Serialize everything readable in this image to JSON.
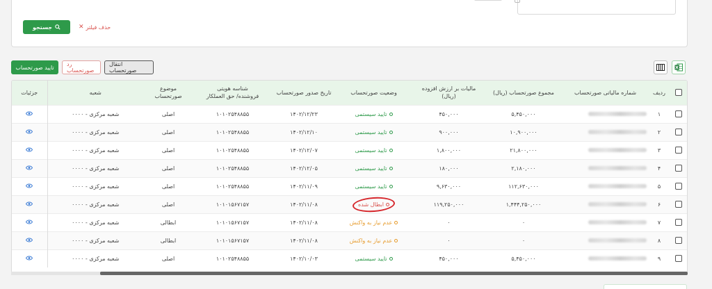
{
  "filters": {
    "search_label": "جستجو",
    "clear_label": "حذف فیلتر"
  },
  "actions": {
    "approve_label": "تایید صورتحساب",
    "reject_label": "رد صورتحساب",
    "transfer_label": "انتقال صورتحساب"
  },
  "table": {
    "headers": {
      "row": "ردیف",
      "tax_number": "شماره مالیاتی صورتحساب",
      "total": "مجموع صورتحساب (ریال)",
      "vat": "مالیات بر ارزش افزوده (ریال)",
      "status": "وضعیت صورتحساب",
      "issue_date": "تاریخ صدور صورتحساب",
      "seller_id_line1": "شناسه هویتی",
      "seller_id_line2": "فروشنده/ حق العملکار",
      "subject": "موضوع صورتحساب",
      "branch": "شعبه",
      "details": "جزئیات"
    },
    "rows": [
      {
        "row": "۱",
        "total": "۵,۴۵۰,۰۰۰",
        "vat": "۴۵۰,۰۰۰",
        "status": "تایید سیستمی",
        "status_type": "green",
        "date": "۱۴۰۲/۱۲/۲۳",
        "seller_id": "۱۰۱۰۲۵۴۸۸۵۵",
        "subject": "اصلی",
        "branch": "شعبه مرکزی - ۰۰۰۰"
      },
      {
        "row": "۲",
        "total": "۱۰,۹۰۰,۰۰۰",
        "vat": "۹۰۰,۰۰۰",
        "status": "تایید سیستمی",
        "status_type": "green",
        "date": "۱۴۰۲/۱۲/۱۰",
        "seller_id": "۱۰۱۰۲۵۴۸۸۵۵",
        "subject": "اصلی",
        "branch": "شعبه مرکزی - ۰۰۰۰"
      },
      {
        "row": "۳",
        "total": "۲۱,۸۰۰,۰۰۰",
        "vat": "۱,۸۰۰,۰۰۰",
        "status": "تایید سیستمی",
        "status_type": "green",
        "date": "۱۴۰۲/۱۲/۰۷",
        "seller_id": "۱۰۱۰۲۵۴۸۸۵۵",
        "subject": "اصلی",
        "branch": "شعبه مرکزی - ۰۰۰۰"
      },
      {
        "row": "۴",
        "total": "۲,۱۸۰,۰۰۰",
        "vat": "۱۸۰,۰۰۰",
        "status": "تایید سیستمی",
        "status_type": "green",
        "date": "۱۴۰۲/۱۲/۰۵",
        "seller_id": "۱۰۱۰۲۵۴۸۸۵۵",
        "subject": "اصلی",
        "branch": "شعبه مرکزی - ۰۰۰۰"
      },
      {
        "row": "۵",
        "total": "۱۱۲,۶۳۰,۰۰۰",
        "vat": "۹,۶۳۰,۰۰۰",
        "status": "تایید سیستمی",
        "status_type": "green",
        "date": "۱۴۰۲/۱۱/۰۹",
        "seller_id": "۱۰۱۰۲۵۴۸۸۵۵",
        "subject": "اصلی",
        "branch": "شعبه مرکزی - ۰۰۰۰"
      },
      {
        "row": "۶",
        "total": "۱,۴۴۴,۲۵۰,۰۰۰",
        "vat": "۱۱۹,۲۵۰,۰۰۰",
        "status": "ابطال شده",
        "status_type": "red",
        "date": "۱۴۰۲/۱۱/۰۸",
        "seller_id": "۱۰۱۰۱۵۶۷۱۵۷",
        "subject": "اصلی",
        "branch": "شعبه مرکزی - ۰۰۰۰"
      },
      {
        "row": "۷",
        "total": "۰",
        "vat": "۰",
        "status": "عدم نیاز به واکنش",
        "status_type": "orange",
        "date": "۱۴۰۲/۱۱/۰۸",
        "seller_id": "۱۰۱۰۱۵۶۷۱۵۷",
        "subject": "ابطالی",
        "branch": "شعبه مرکزی - ۰۰۰۰"
      },
      {
        "row": "۸",
        "total": "۰",
        "vat": "۰",
        "status": "عدم نیاز به واکنش",
        "status_type": "orange",
        "date": "۱۴۰۲/۱۱/۰۸",
        "seller_id": "۱۰۱۰۱۵۶۷۱۵۷",
        "subject": "ابطالی",
        "branch": "شعبه مرکزی - ۰۰۰۰"
      },
      {
        "row": "۹",
        "total": "۵,۴۵۰,۰۰۰",
        "vat": "۴۵۰,۰۰۰",
        "status": "تایید سیستمی",
        "status_type": "green",
        "date": "۱۴۰۲/۱۰/۰۳",
        "seller_id": "۱۰۱۰۲۵۴۸۸۵۵",
        "subject": "اصلی",
        "branch": "شعبه مرکزی - ۰۰۰۰"
      }
    ]
  },
  "colors": {
    "primary_green": "#2e9a4a",
    "header_bg": "#e8f5e9",
    "status_green": "#2e9a4a",
    "status_red": "#d9534f",
    "status_orange": "#e69a2a",
    "annotation_circle": "#d6262b",
    "eye_icon": "#3a7bd5"
  },
  "icons": {
    "columns_toggle": "columns-icon",
    "excel_export": "excel-icon",
    "search": "search-icon",
    "clear": "close-icon",
    "details": "eye-icon"
  }
}
